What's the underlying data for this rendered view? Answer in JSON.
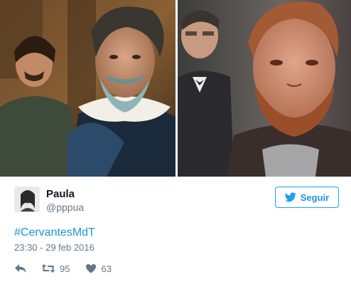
{
  "tweet": {
    "author_name": "Paula",
    "author_handle": "@pppua",
    "hashtag": "#CervantesMdT",
    "timestamp": "23:30 - 29 feb 2016",
    "retweet_count": "95",
    "like_count": "63"
  },
  "follow_button": {
    "label": "Seguir",
    "icon": "twitter-bird-icon"
  },
  "icons": {
    "reply": "reply-icon",
    "retweet": "retweet-icon",
    "like": "heart-icon"
  },
  "colors": {
    "accent": "#1da1f2",
    "link": "#1b95e0",
    "muted": "#657786",
    "name": "#14171a"
  }
}
